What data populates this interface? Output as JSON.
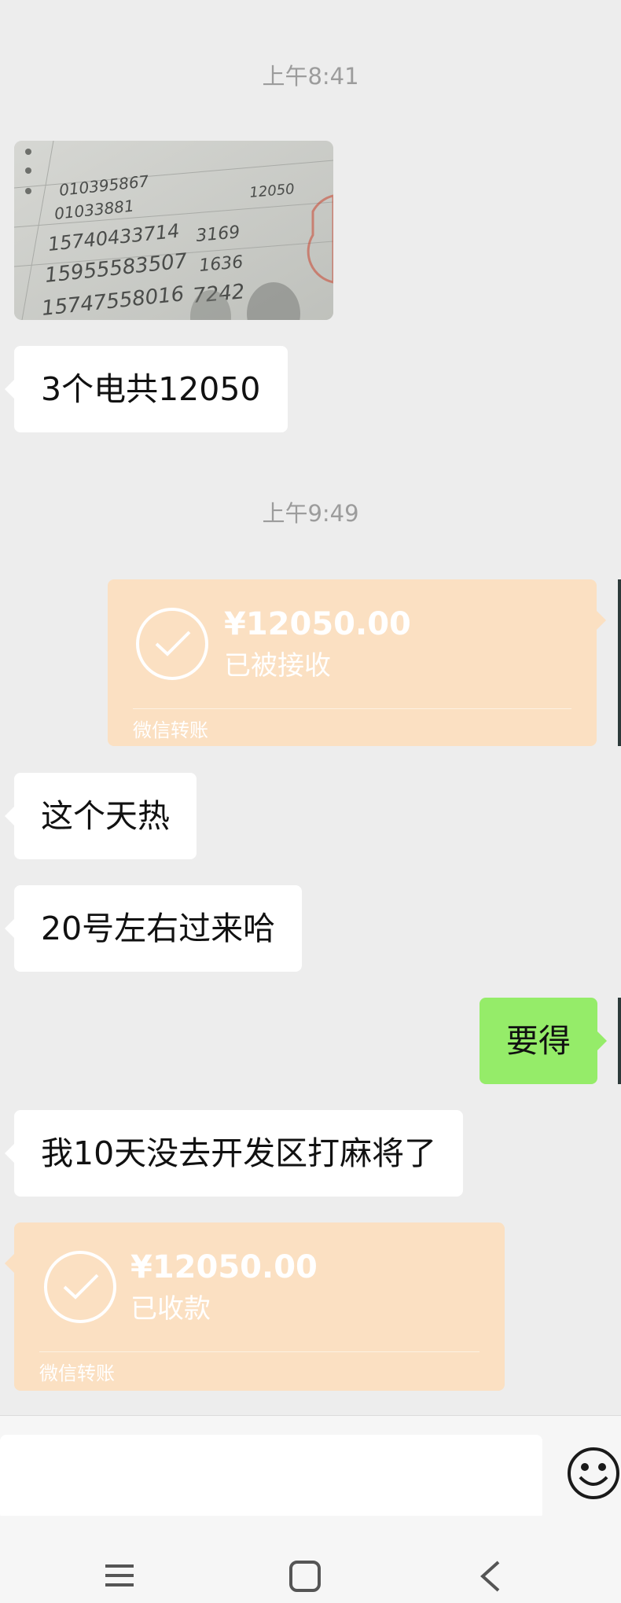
{
  "messages": {
    "time1": "上午8:41",
    "photo_lines": [
      "010395867",
      "01033881",
      "15740433714",
      "15955583507",
      "15747558016"
    ],
    "photo_values": [
      "12050",
      "3169",
      "1636",
      "7242"
    ],
    "msg1": "3个电共12050",
    "time2": "上午9:49",
    "transfer1": {
      "amount": "¥12050.00",
      "status": "已被接收",
      "label": "微信转账"
    },
    "msg2": "这个天热",
    "msg3": "20号左右过来哈",
    "msg4_out": "要得",
    "msg5": "我10天没去开发区打麻将了",
    "transfer2": {
      "amount": "¥12050.00",
      "status": "已收款",
      "label": "微信转账"
    }
  },
  "input": {
    "placeholder": ""
  },
  "icons": {
    "emoji": "emoji-smiley-icon",
    "nav_menu": "menu-icon",
    "nav_home": "home-square-icon",
    "nav_back": "back-chevron-icon"
  },
  "colors": {
    "background": "#ededed",
    "incoming_bubble": "#ffffff",
    "outgoing_bubble": "#95ec69",
    "transfer_bubble": "#fbe0c2",
    "timestamp": "#9c9c9c"
  }
}
